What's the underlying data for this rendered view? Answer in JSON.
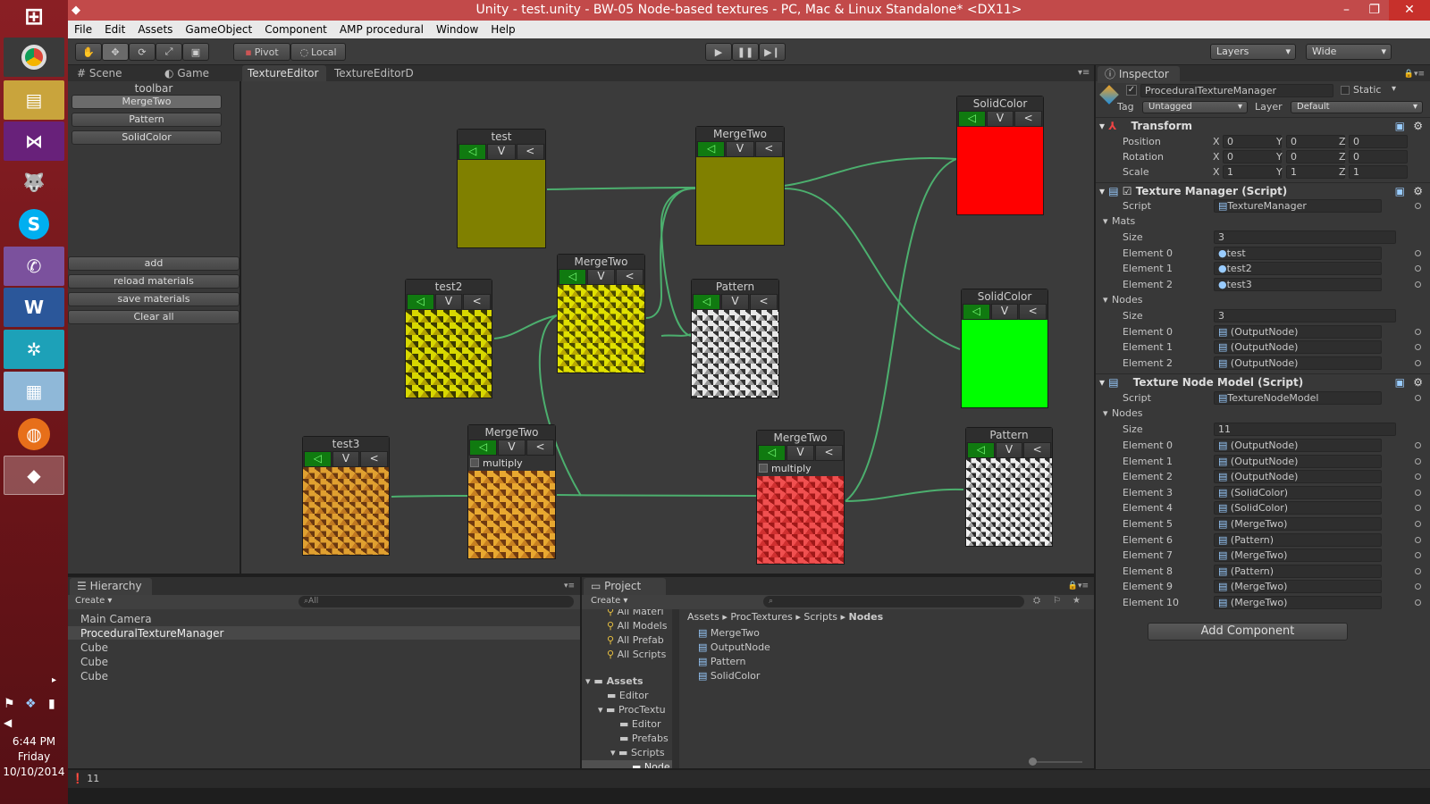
{
  "window": {
    "title": "Unity - test.unity - BW-05 Node-based textures - PC, Mac & Linux Standalone* <DX11>"
  },
  "menu": [
    "File",
    "Edit",
    "Assets",
    "GameObject",
    "Component",
    "AMP procedural",
    "Window",
    "Help"
  ],
  "toolbar": {
    "pivot": "Pivot",
    "local": "Local",
    "layers": "Layers",
    "layout": "Wide"
  },
  "scene_tabs": {
    "scene": "Scene",
    "game": "Game"
  },
  "editor_tabs": [
    "TextureEditor",
    "TextureEditorD"
  ],
  "left_panel": {
    "title": "toolbar",
    "items": [
      "MergeTwo",
      "Pattern",
      "SolidColor"
    ],
    "actions": [
      "add",
      "reload materials",
      "save materials",
      "Clear all"
    ]
  },
  "nodes": {
    "test": "test",
    "test2": "test2",
    "test3": "test3",
    "merge": "MergeTwo",
    "pattern": "Pattern",
    "solid": "SolidColor",
    "btn_v": "V",
    "btn_lt": "<",
    "btn_out": "◁",
    "multiply": "multiply"
  },
  "colors": {
    "olive": "#808000",
    "red": "#ff0000",
    "green": "#00ff00"
  },
  "hierarchy": {
    "tab": "Hierarchy",
    "create": "Create",
    "search": "All",
    "items": [
      "Main Camera",
      "ProceduralTextureManager",
      "Cube",
      "Cube",
      "Cube"
    ]
  },
  "project": {
    "tab": "Project",
    "create": "Create",
    "favorites": [
      "All Materi",
      "All Models",
      "All Prefab",
      "All Scripts"
    ],
    "tree": [
      "Assets",
      "Editor",
      "ProcTextu",
      "Editor",
      "Prefabs",
      "Scripts",
      "Node"
    ],
    "breadcrumb": [
      "Assets",
      "ProcTextures",
      "Scripts",
      "Nodes"
    ],
    "files": [
      "MergeTwo",
      "OutputNode",
      "Pattern",
      "SolidColor"
    ]
  },
  "inspector": {
    "tab": "Inspector",
    "object": "ProceduralTextureManager",
    "static": "Static",
    "tag_label": "Tag",
    "tag": "Untagged",
    "layer_label": "Layer",
    "layer": "Default",
    "transform": {
      "title": "Transform",
      "position": "Position",
      "rotation": "Rotation",
      "scale": "Scale",
      "pos": [
        "0",
        "0",
        "0"
      ],
      "rot": [
        "0",
        "0",
        "0"
      ],
      "scl": [
        "1",
        "1",
        "1"
      ],
      "axes": [
        "X",
        "Y",
        "Z"
      ]
    },
    "tm": {
      "title": "Texture Manager (Script)",
      "script_label": "Script",
      "script": "TextureManager",
      "mats": "Mats",
      "size_label": "Size",
      "mats_size": "3",
      "mats_items": [
        {
          "label": "Element 0",
          "value": "test"
        },
        {
          "label": "Element 1",
          "value": "test2"
        },
        {
          "label": "Element 2",
          "value": "test3"
        }
      ],
      "nodes": "Nodes",
      "nodes_size": "3",
      "nodes_items": [
        {
          "label": "Element 0",
          "value": "(OutputNode)"
        },
        {
          "label": "Element 1",
          "value": "(OutputNode)"
        },
        {
          "label": "Element 2",
          "value": "(OutputNode)"
        }
      ]
    },
    "tnm": {
      "title": "Texture Node Model (Script)",
      "script_label": "Script",
      "script": "TextureNodeModel",
      "nodes": "Nodes",
      "size_label": "Size",
      "size": "11",
      "items": [
        {
          "label": "Element 0",
          "value": "(OutputNode)"
        },
        {
          "label": "Element 1",
          "value": "(OutputNode)"
        },
        {
          "label": "Element 2",
          "value": "(OutputNode)"
        },
        {
          "label": "Element 3",
          "value": "(SolidColor)"
        },
        {
          "label": "Element 4",
          "value": "(SolidColor)"
        },
        {
          "label": "Element 5",
          "value": "(MergeTwo)"
        },
        {
          "label": "Element 6",
          "value": "(Pattern)"
        },
        {
          "label": "Element 7",
          "value": "(MergeTwo)"
        },
        {
          "label": "Element 8",
          "value": "(Pattern)"
        },
        {
          "label": "Element 9",
          "value": "(MergeTwo)"
        },
        {
          "label": "Element 10",
          "value": "(MergeTwo)"
        }
      ]
    },
    "add_component": "Add Component"
  },
  "status": {
    "count": "11"
  },
  "clock": {
    "time": "6:44 PM",
    "day": "Friday",
    "date": "10/10/2014"
  }
}
